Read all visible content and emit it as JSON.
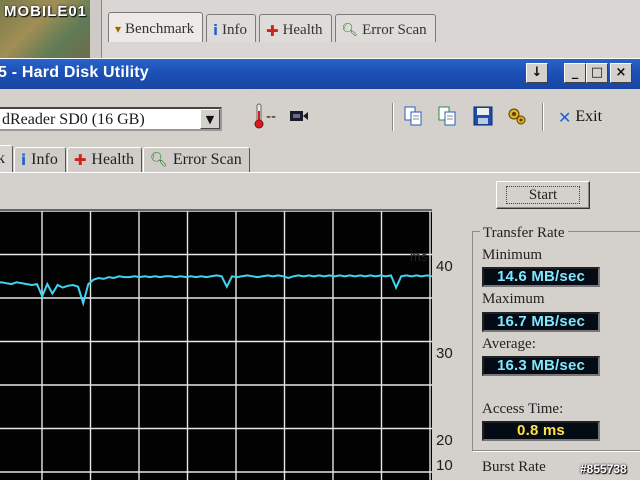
{
  "watermark": {
    "logo": "MOBILE01",
    "image_id": "#855738"
  },
  "background_window": {
    "tabs": [
      {
        "label": "Benchmark",
        "icon": "benchmark-icon"
      },
      {
        "label": "Info",
        "icon": "info-icon"
      },
      {
        "label": "Health",
        "icon": "health-cross-icon"
      },
      {
        "label": "Error Scan",
        "icon": "magnifier-icon"
      }
    ]
  },
  "window": {
    "title": "5 - Hard Disk Utility",
    "controls": [
      "↓",
      "_",
      "□",
      "×"
    ]
  },
  "toolbar": {
    "drive": "dReader SD0 (16 GB)",
    "temperature": "--",
    "exit_label": "Exit"
  },
  "tabs": [
    {
      "label": "k",
      "icon": ""
    },
    {
      "label": "Info",
      "icon": "info-icon"
    },
    {
      "label": "Health",
      "icon": "health-cross-icon"
    },
    {
      "label": "Error Scan",
      "icon": "magnifier-icon"
    }
  ],
  "chart_data": {
    "type": "line",
    "series": [
      {
        "values": [
          31.7,
          31.8,
          31.7,
          31.6,
          31.8,
          31.7,
          31.6,
          31.5,
          31.6,
          30.2,
          31.6,
          30.5,
          31.5,
          31.2,
          31.4,
          31.5,
          31.3,
          29.4,
          31.6,
          32.1,
          32.3,
          32.2,
          32.4,
          32.3,
          32.5,
          32.4,
          32.4,
          32.5,
          32.4,
          32.5,
          32.4,
          32.5,
          32.4,
          32.5,
          32.5,
          32.4,
          32.5,
          32.4,
          32.5,
          32.4,
          32.5,
          32.4,
          32.5,
          32.6,
          32.5,
          31.3,
          32.5,
          32.4,
          32.5,
          32.6,
          32.5,
          32.4,
          32.5,
          32.6,
          32.5,
          32.6,
          32.5,
          32.3,
          32.5,
          32.6,
          32.5,
          32.6,
          32.5,
          32.6,
          32.5,
          32.6,
          32.5,
          32.6,
          32.5,
          32.6,
          32.5,
          32.6,
          32.5,
          32.6,
          32.5,
          32.6,
          32.5,
          32.6,
          31.2,
          32.5,
          32.6,
          32.5,
          32.6,
          32.5,
          32.6,
          32.5
        ]
      }
    ],
    "unit_label": "ms",
    "y_ticks": [
      "40",
      "30",
      "20",
      "10"
    ],
    "ylim": [
      10,
      40
    ],
    "grid": true
  },
  "transfer_rate": {
    "title": "Transfer Rate",
    "minimum_label": "Minimum",
    "minimum_value": "14.6 MB/sec",
    "maximum_label": "Maximum",
    "maximum_value": "16.7 MB/sec",
    "average_label": "Average:",
    "average_value": "16.3 MB/sec"
  },
  "access_time": {
    "label": "Access Time:",
    "value": "0.8 ms"
  },
  "burst_rate": {
    "label": "Burst Rate"
  },
  "start_label": "Start",
  "colors": {
    "titlebar": "#1b4fb4",
    "lcd_text": "#7fe8ff",
    "lcd_yellow": "#ffe24a",
    "graph_line": "#3fd4f2"
  }
}
